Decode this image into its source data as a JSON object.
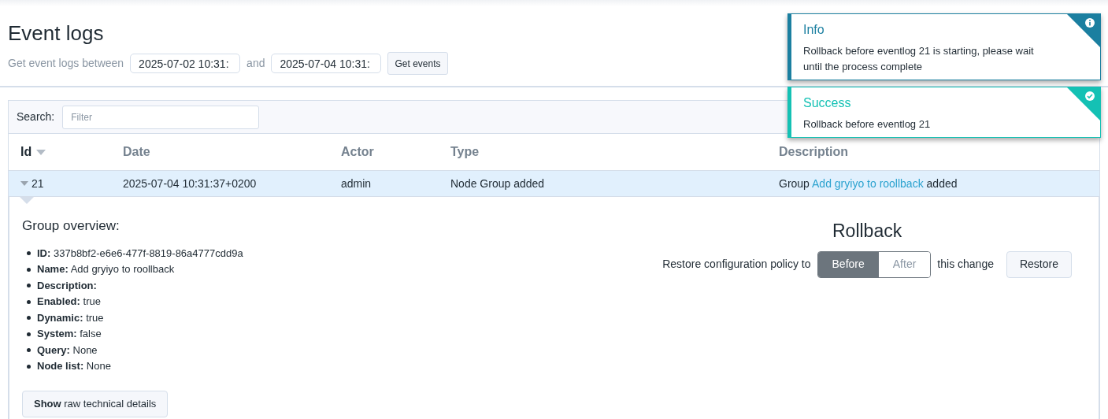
{
  "header": {
    "title": "Event logs",
    "range_label": "Get event logs between",
    "start": "2025-07-02 10:31:",
    "joiner": "and",
    "end": "2025-07-04 10:31:",
    "button": "Get events"
  },
  "search": {
    "label": "Search:",
    "placeholder": "Filter"
  },
  "table": {
    "columns": [
      {
        "label": "Id",
        "sorted": true
      },
      {
        "label": "Date",
        "sorted": false
      },
      {
        "label": "Actor",
        "sorted": false
      },
      {
        "label": "Type",
        "sorted": false
      },
      {
        "label": "Description",
        "sorted": false
      }
    ],
    "rows": [
      {
        "id": "21",
        "expanded": true,
        "selected": true,
        "date": "2025-07-04 10:31:37+0200",
        "actor": "admin",
        "type": "Node Group added",
        "description": {
          "prefix": "Group",
          "link": "Add gryiyo to roollback",
          "suffix": "added"
        }
      }
    ]
  },
  "details": {
    "title": "Group overview:",
    "items": [
      "**ID:** 337b8bf2-e6e6-477f-8819-86a4777cdd9a",
      "**Name:** Add gryiyo to roollback",
      "**Description:**",
      "**Enabled:** true",
      "**Dynamic:** true",
      "**System:** false",
      "**Query:** None",
      "**Node list:** None"
    ],
    "button": "**Show** raw technical details"
  },
  "rollback": {
    "title": "Rollback",
    "prefix": "Restore configuration policy to",
    "options": [
      {
        "label": "Before",
        "selected": true
      },
      {
        "label": "After",
        "selected": false
      }
    ],
    "suffix": "this change",
    "button": "Restore"
  },
  "toasts": [
    {
      "kind": "info",
      "title": "Info",
      "message": "Rollback before eventlog 21 is starting, please wait until the process complete"
    },
    {
      "kind": "success",
      "title": "Success",
      "message": "Rollback before eventlog 21"
    }
  ]
}
